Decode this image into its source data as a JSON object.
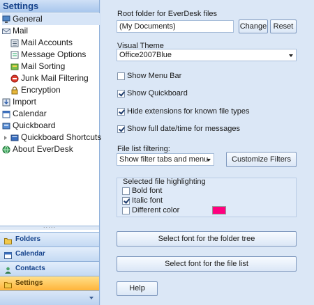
{
  "nav": {
    "header": "Settings",
    "tree": [
      {
        "label": "General",
        "icon": "monitor-icon",
        "level": 0,
        "selected": true
      },
      {
        "label": "Mail",
        "icon": "mail-icon",
        "level": 0
      },
      {
        "label": "Mail Accounts",
        "icon": "accounts-icon",
        "level": 1
      },
      {
        "label": "Message Options",
        "icon": "options-icon",
        "level": 1
      },
      {
        "label": "Mail Sorting",
        "icon": "sorting-icon",
        "level": 1
      },
      {
        "label": "Junk Mail Filtering",
        "icon": "junk-icon",
        "level": 1
      },
      {
        "label": "Encryption",
        "icon": "lock-icon",
        "level": 1
      },
      {
        "label": "Import",
        "icon": "import-icon",
        "level": 0
      },
      {
        "label": "Calendar",
        "icon": "calendar-icon",
        "level": 0
      },
      {
        "label": "Quickboard",
        "icon": "quickboard-icon",
        "level": 0
      },
      {
        "label": "Quickboard Shortcuts",
        "icon": "shortcuts-icon",
        "level": 1,
        "expander": true
      },
      {
        "label": "About EverDesk",
        "icon": "globe-icon",
        "level": 0
      }
    ],
    "buttons": [
      {
        "label": "Folders",
        "icon": "folder-icon"
      },
      {
        "label": "Calendar",
        "icon": "calendar-icon"
      },
      {
        "label": "Contacts",
        "icon": "contacts-icon"
      },
      {
        "label": "Settings",
        "icon": "settings-icon",
        "active": true
      }
    ]
  },
  "panel": {
    "root_folder_label": "Root folder for EverDesk files",
    "root_folder_value": "(My Documents)",
    "change_label": "Change",
    "reset_label": "Reset",
    "visual_theme_label": "Visual Theme",
    "visual_theme_value": "Office2007Blue",
    "show_menu_bar": "Show Menu Bar",
    "show_quickboard": "Show Quickboard",
    "hide_extensions": "Hide extensions for known file types",
    "show_full_datetime": "Show full date/time for messages",
    "file_list_filtering_label": "File list filtering:",
    "file_list_filtering_value": "Show filter tabs and menu",
    "customize_filters_label": "Customize Filters",
    "highlighting_label": "Selected file highlighting",
    "bold_font": "Bold font",
    "italic_font": "Italic font",
    "different_color": "Different color",
    "highlight_color": "#ff007f",
    "folder_tree_font_label": "Select font for the folder tree",
    "file_list_font_label": "Select font for the file list",
    "help_label": "Help"
  },
  "colors": {
    "accent": "#15428b",
    "active_tab": "#ffb43a"
  }
}
